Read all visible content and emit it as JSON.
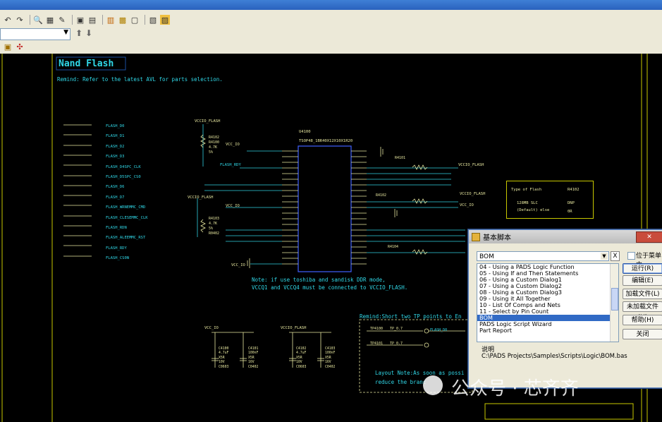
{
  "toolbar": {
    "combo_value": "",
    "icons": [
      "undo-icon",
      "redo-icon",
      "zoom-icon",
      "board-icon",
      "route-icon",
      "component-icon",
      "netlist-icon",
      "chart-icon",
      "layer-icon",
      "window-icon",
      "report-icon",
      "print-icon",
      "export-icon"
    ]
  },
  "schematic": {
    "title": "Nand Flash",
    "remind": "Remind: Refer to the latest AVL for parts selection.",
    "left_nets": [
      "FLASH_D0",
      "FLASH_D1",
      "FLASH_D2",
      "FLASH_D3",
      "FLASH_D4SPC_CLK",
      "FLASH_D5SPC_CS0",
      "FLASH_D6",
      "FLASH_D7",
      "FLASH_WRNEMMC_CMD",
      "FLASH_CLESEMMC_CLK",
      "FLASH_RDN",
      "FLASH_ALEEMMC_RST",
      "FLASH_RDY",
      "FLASH_CS0N"
    ],
    "ic_ref": "U4100",
    "ic_part": "TSOP48_1BR40X12X10X1R20",
    "vccio_flash": "VCCIO_FLASH",
    "vcc_io": "VCC_IO",
    "r4102": "R4102",
    "r4100": "R4100",
    "r4101": "R4101",
    "r4103": "R4103",
    "r4104": "R4104",
    "r_value": "4.7K",
    "r_tol": "5%",
    "r0402": "R0402",
    "flash_rdy": "FLASH_RDY",
    "note_line1": "Note: if use toshiba and sandisk DDR mode,",
    "note_line2": "VCCQ1 and VCCQ4 must be connected to VCCIO_FLASH.",
    "remind_short": "Remind:Short two TP points to En",
    "layout_note_1": "Layout Note:As soon as possi",
    "layout_note_2": "reduce the branc",
    "table": {
      "headers": [
        "Type of Flash",
        "R4102"
      ],
      "rows": [
        [
          "128MB SLC",
          "DNP"
        ],
        [
          "(Default) else",
          "0R"
        ]
      ]
    },
    "caps_left": {
      "ref1": "C4100",
      "ref2": "C4101",
      "v1": "4.7uF",
      "v2": "100nF",
      "d1": "X5R",
      "d2": "X5R",
      "vv1": "10V",
      "vv2": "16V",
      "p1": "C0603",
      "p2": "C0402",
      "rail": "VCC_IO"
    },
    "caps_right": {
      "ref1": "C4102",
      "ref2": "C4103",
      "v1": "4.7uF",
      "v2": "100nF",
      "d1": "X5R",
      "d2": "X5R",
      "vv1": "10V",
      "vv2": "16V",
      "p1": "C0603",
      "p2": "C0402",
      "rail": "VCCIO_FLASH"
    },
    "tp1": "TP4100",
    "tp2": "TP4101",
    "tp_d7": "TP_0.7",
    "flash_d0": "FLASH_D0"
  },
  "dialog": {
    "title": "基本脚本",
    "combo": "BOM",
    "x_label": "X",
    "checkbox_label": "位于菜单中",
    "list": [
      "04 - Using a PADS Logic Function",
      "05 - Using If and Then Statements",
      "06 - Using a Custom Dialog1",
      "07 - Using a Custom Dialog2",
      "08 - Using a Custom Dialog3",
      "09 - Using it All Together",
      "10 - List Of Comps and Nets",
      "11 - Select by Pin Count",
      "BOM",
      "PADS Logic Script Wizard",
      "Part Report"
    ],
    "selected": "BOM",
    "buttons": [
      "运行(R)",
      "编辑(E)",
      "加载文件(L)",
      "未加载文件(U)",
      "帮助(H)",
      "关闭"
    ],
    "desc_label": "说明",
    "desc_path": "C:\\PADS Projects\\Samples\\Scripts\\Logic\\BOM.bas"
  },
  "watermark": "公众号 · 芯齐齐"
}
